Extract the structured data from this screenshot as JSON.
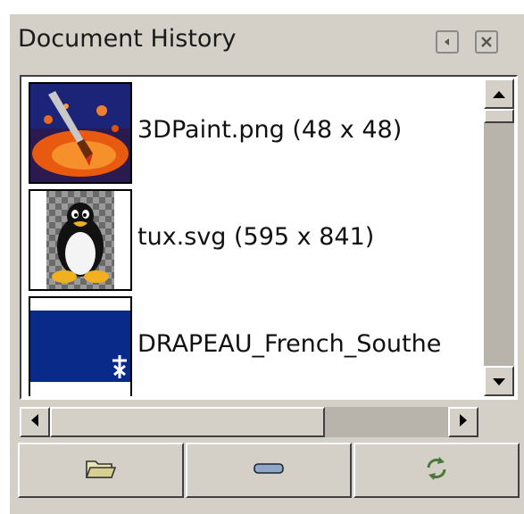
{
  "panel": {
    "title": "Document History"
  },
  "titlebar_buttons": [
    {
      "icon": "tab-menu-icon"
    },
    {
      "icon": "close-icon"
    }
  ],
  "documents": [
    {
      "label": "3DPaint.png (48 x 48)",
      "thumbnail": "3dpaint-thumbnail"
    },
    {
      "label": "tux.svg (595 x 841)",
      "thumbnail": "tux-thumbnail"
    },
    {
      "label": "DRAPEAU_French_Southe",
      "thumbnail": "flag-thumbnail"
    }
  ],
  "scrollbars": {
    "vertical": {
      "up_icon": "arrow-up-icon",
      "down_icon": "arrow-down-icon"
    },
    "horizontal": {
      "left_icon": "arrow-left-icon",
      "right_icon": "arrow-right-icon"
    }
  },
  "actions": [
    {
      "icon": "open-folder-icon"
    },
    {
      "icon": "remove-icon"
    },
    {
      "icon": "refresh-icon"
    }
  ],
  "colors": {
    "panel_bg": "#d4d0c8",
    "list_bg": "#ffffff",
    "flag_blue": "#0a2a8a"
  }
}
